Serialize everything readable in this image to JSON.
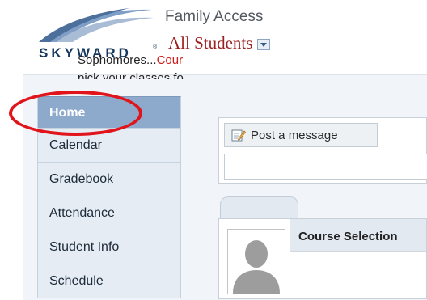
{
  "header": {
    "logo_text": "SKYWARD",
    "logo_reg": "®",
    "app_title": "Family Access",
    "student_selector": "All Students"
  },
  "sidebar": {
    "items": [
      {
        "label": "Home",
        "active": true
      },
      {
        "label": "Calendar"
      },
      {
        "label": "Gradebook"
      },
      {
        "label": "Attendance"
      },
      {
        "label": "Student Info"
      },
      {
        "label": "Schedule"
      }
    ]
  },
  "main": {
    "post_tab_label": "Post a message",
    "message": {
      "title": "Course Selection",
      "body_start": "Sophomores...",
      "body_highlight": "Cour",
      "body_line2": "pick your classes fo"
    }
  },
  "colors": {
    "accent": "#8da9cb",
    "annotation": "#e0141a",
    "student_name": "#9c1f1f"
  }
}
